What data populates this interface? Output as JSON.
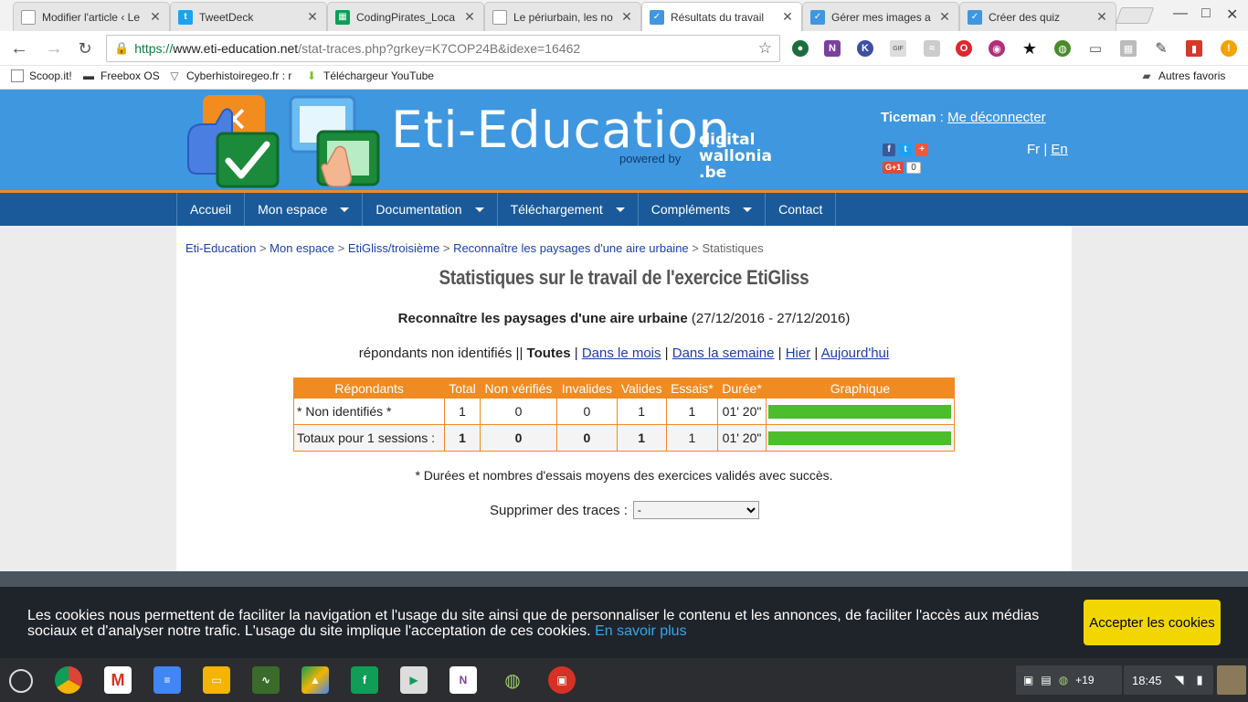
{
  "browser": {
    "tabs": [
      {
        "title": "Modifier l'article ‹ Le",
        "icon_color": "#777777",
        "glyph": ""
      },
      {
        "title": "TweetDeck",
        "icon_color": "#1da1f2",
        "glyph": "t"
      },
      {
        "title": "CodingPirates_Loca",
        "icon_color": "#0f9d58",
        "glyph": "▦"
      },
      {
        "title": "Le périurbain, les no",
        "icon_color": "#777777",
        "glyph": ""
      },
      {
        "title": "Résultats du travail",
        "icon_color": "#3f97df",
        "glyph": "✓"
      },
      {
        "title": "Gérer mes images a",
        "icon_color": "#3f97df",
        "glyph": "✓"
      },
      {
        "title": "Créer des quiz",
        "icon_color": "#3f97df",
        "glyph": "✓"
      }
    ],
    "url": {
      "scheme": "https://",
      "host": "www.eti-education.net",
      "path": "/stat-traces.php?grkey=K7COP24B&idexe=16462"
    },
    "bookmarks": [
      {
        "label": "Scoop.it!",
        "icon": "page-icon"
      },
      {
        "label": "Freebox OS",
        "icon": "freebox-icon"
      },
      {
        "label": "Cyberhistoiregeo.fr : r",
        "icon": "fox-icon"
      },
      {
        "label": "Téléchargeur YouTube",
        "icon": "download-icon"
      }
    ],
    "other_bookmarks": "Autres favoris"
  },
  "site": {
    "brand": "Eti-Education",
    "powered": "powered by",
    "dw": [
      "digital",
      "wallonia",
      ".be"
    ],
    "user": "Ticeman",
    "user_sep": " : ",
    "logout": "Me déconnecter",
    "lang_fr": "Fr",
    "lang_sep": " | ",
    "lang_en": "En",
    "gplus_label": "G+1",
    "gplus_count": "0",
    "menu": [
      {
        "label": "Accueil",
        "dropdown": false
      },
      {
        "label": "Mon espace",
        "dropdown": true
      },
      {
        "label": "Documentation",
        "dropdown": true
      },
      {
        "label": "Téléchargement",
        "dropdown": true
      },
      {
        "label": "Compléments",
        "dropdown": true
      },
      {
        "label": "Contact",
        "dropdown": false
      }
    ]
  },
  "breadcrumb": {
    "items": [
      "Eti-Education",
      "Mon espace",
      "EtiGliss/troisième",
      "Reconnaître les paysages d'une aire urbaine"
    ],
    "separator": " > ",
    "current": "Statistiques"
  },
  "page": {
    "title": "Statistiques sur le travail de l'exercice EtiGliss",
    "exercise": "Reconnaître les paysages d'une aire urbaine",
    "dates": " (27/12/2016 - 27/12/2016)",
    "filter_prefix": "répondants non identifiés || ",
    "filter_active": "Toutes",
    "filters": [
      "Dans le mois",
      "Dans la semaine",
      "Hier",
      "Aujourd'hui"
    ],
    "filter_sep": " | "
  },
  "table": {
    "headers": [
      "Répondants",
      "Total",
      "Non vérifiés",
      "Invalides",
      "Valides",
      "Essais*",
      "Durée*",
      "Graphique"
    ],
    "rows": [
      {
        "respondent": "* Non identifiés *",
        "total": "1",
        "unverified": "0",
        "invalid": "0",
        "valid": "1",
        "tries": "1",
        "duration": "01' 20\"",
        "graph_fraction": 1.0
      },
      {
        "respondent": "Totaux pour 1 sessions :",
        "total": "1",
        "unverified": "0",
        "invalid": "0",
        "valid": "1",
        "tries": "1",
        "duration": "01' 20\"",
        "graph_fraction": 1.0
      }
    ],
    "bar_color": "#4cbd2b"
  },
  "note": "* Durées et nombres d'essais moyens des exercices validés avec succès.",
  "purge": {
    "label": "Supprimer des traces :",
    "selected": "-"
  },
  "cookie": {
    "text": "Les cookies nous permettent de faciliter la navigation et l'usage du site ainsi que de personnaliser le contenu et les annonces, de faciliter l'accès aux médias sociaux et d'analyser notre trafic. L'usage du site implique l'acceptation de ces cookies.",
    "link": "En savoir plus",
    "button": "Accepter les cookies"
  },
  "shelf": {
    "notif_count": "+19",
    "time": "18:45"
  },
  "colors": {
    "header_blue": "#3f97df",
    "nav_blue": "#1a5a9a",
    "accent_orange": "#f08b22",
    "cookie_button": "#f1d600"
  }
}
